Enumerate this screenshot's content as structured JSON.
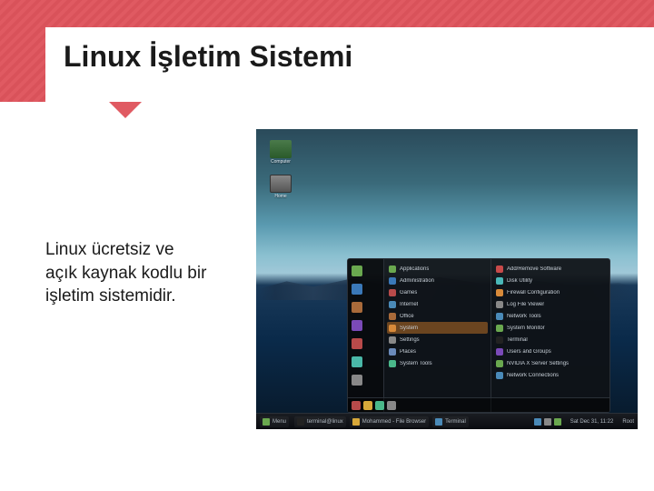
{
  "slide": {
    "title": "Linux İşletim Sistemi",
    "body_text": "Linux ücretsiz ve açık kaynak kodlu bir işletim sistemidir."
  },
  "screenshot": {
    "desktop_icons": [
      {
        "label": "Computer"
      },
      {
        "label": "Home"
      }
    ],
    "menu_categories_left": [
      {
        "color": "#6aa84f"
      },
      {
        "color": "#3a78b8"
      },
      {
        "color": "#a86a3a"
      },
      {
        "color": "#7a4ab8"
      },
      {
        "color": "#b84a4a"
      },
      {
        "color": "#4ab8a8"
      },
      {
        "color": "#888"
      }
    ],
    "menu_mid": [
      {
        "label": "Applications",
        "color": "#6aa84f"
      },
      {
        "label": "Administration",
        "color": "#3a78b8"
      },
      {
        "label": "Games",
        "color": "#b84a4a"
      },
      {
        "label": "Internet",
        "color": "#4a8ab8"
      },
      {
        "label": "Office",
        "color": "#a86a3a"
      },
      {
        "label": "System",
        "color": "#d88a3a",
        "selected": true
      },
      {
        "label": "Settings",
        "color": "#888"
      },
      {
        "label": "Places",
        "color": "#6a8aba"
      },
      {
        "label": "System Tools",
        "color": "#4ab88a"
      }
    ],
    "menu_right": [
      {
        "label": "Add/Remove Software",
        "color": "#c84a4a"
      },
      {
        "label": "Disk Utility",
        "color": "#4ab8b8"
      },
      {
        "label": "Firewall Configuration",
        "color": "#d88a3a"
      },
      {
        "label": "Log File Viewer",
        "color": "#888"
      },
      {
        "label": "Network Tools",
        "color": "#4a8ab8"
      },
      {
        "label": "System Monitor",
        "color": "#6aa84f"
      },
      {
        "label": "Terminal",
        "color": "#222"
      },
      {
        "label": "Users and Groups",
        "color": "#7a4ab8"
      },
      {
        "label": "NVIDIA X Server Settings",
        "color": "#6aa84f"
      },
      {
        "label": "Network Connections",
        "color": "#4a8ab8"
      }
    ],
    "menu_bottom_icons": [
      {
        "color": "#b84a4a"
      },
      {
        "color": "#d8a83a"
      },
      {
        "color": "#4ab88a"
      },
      {
        "color": "#888"
      }
    ],
    "taskbar": {
      "start_label": "Menu",
      "items": [
        {
          "label": "terminal@linux",
          "color": "#222"
        },
        {
          "label": "Mohammed - File Browser",
          "color": "#d8a83a"
        },
        {
          "label": "Terminal",
          "color": "#4a8ab8"
        }
      ],
      "tray_icons": [
        {
          "color": "#4a8ab8"
        },
        {
          "color": "#888"
        },
        {
          "color": "#6aa84f"
        }
      ],
      "clock": "Sat Dec 31, 11:22",
      "user": "Root"
    }
  }
}
